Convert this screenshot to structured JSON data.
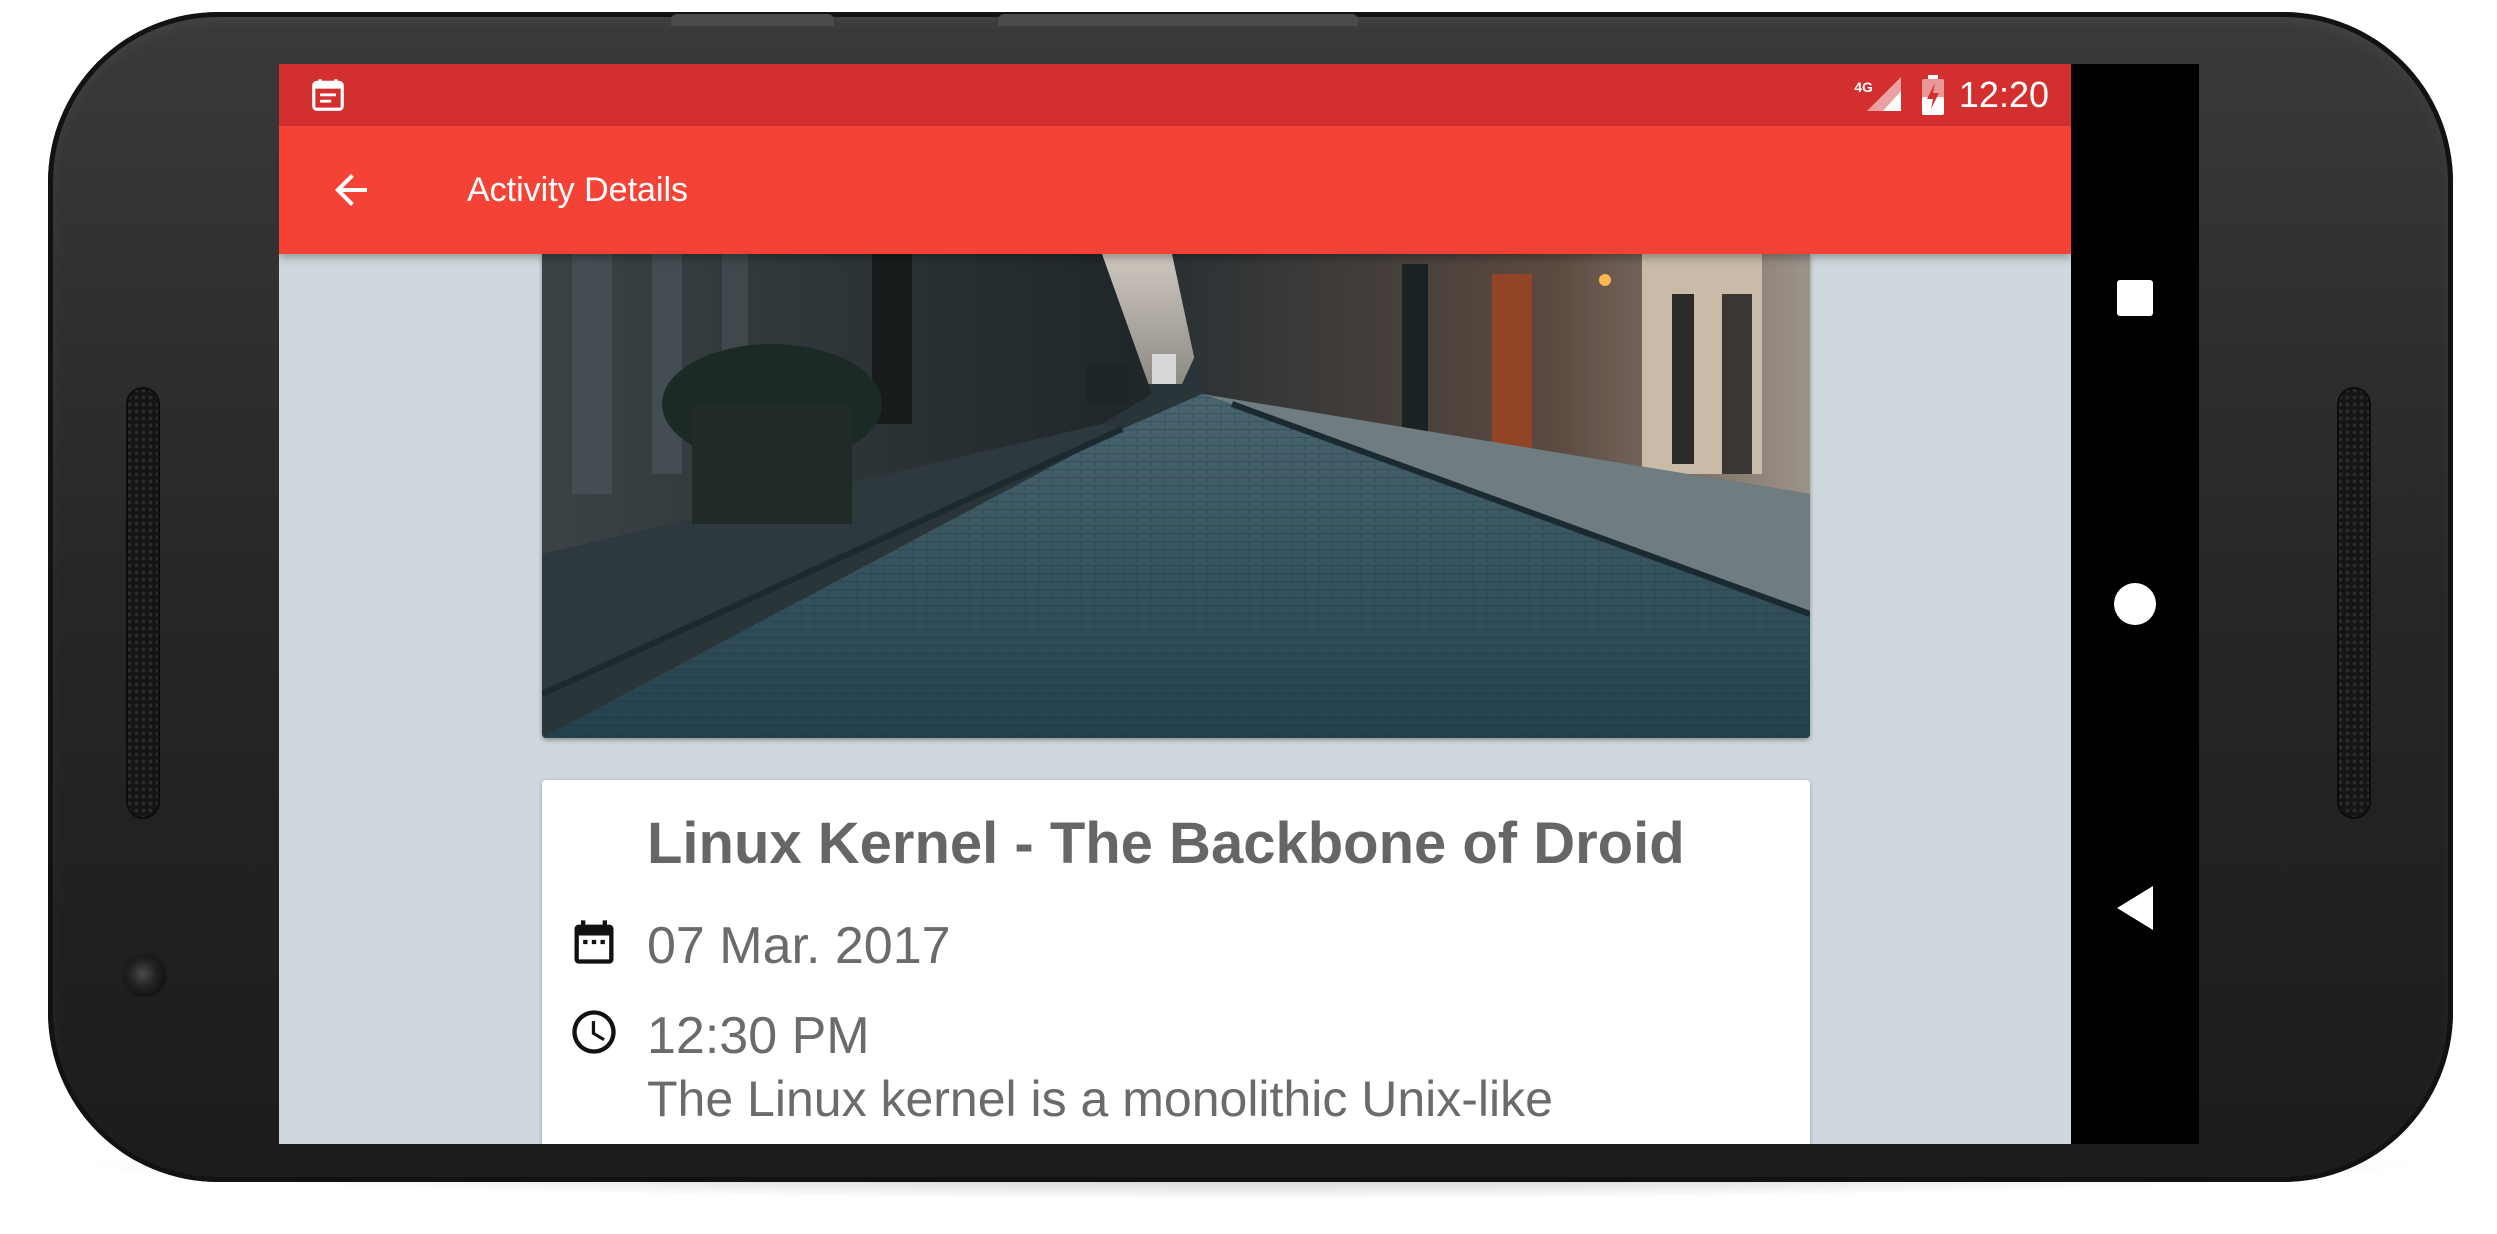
{
  "status_bar": {
    "network_label": "4G",
    "time": "12:20",
    "left_icon": "calendar-notification-icon"
  },
  "toolbar": {
    "back_icon": "arrow-back-icon",
    "title": "Activity Details"
  },
  "banner": {
    "icon": "street-photo",
    "description_hidden": ""
  },
  "details": {
    "title": "Linux Kernel - The Backbone of Droid",
    "date_icon": "calendar-icon",
    "date": "07 Mar. 2017",
    "time_icon": "clock-icon",
    "time": "12:30 PM",
    "description": "The Linux kernel is a monolithic Unix-like"
  },
  "nav_bar": {
    "recents_icon": "square-recents-icon",
    "home_icon": "circle-home-icon",
    "back_icon": "triangle-back-icon"
  },
  "colors": {
    "status_bar": "#d32f2f",
    "toolbar": "#f44336",
    "background": "#cfd8dc",
    "card_text": "#666666"
  }
}
